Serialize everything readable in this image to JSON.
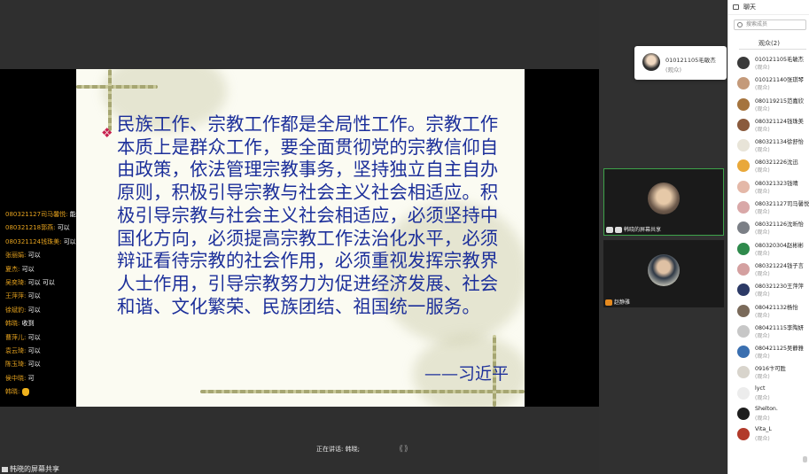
{
  "slide": {
    "bullet": "❖",
    "text": "民族工作、宗教工作都是全局性工作。宗教工作本质上是群众工作，要全面贯彻党的宗教信仰自由政策，依法管理宗教事务，坚持独立自主自办原则，积极引导宗教与社会主义社会相适应。积极引导宗教与社会主义社会相适应，必须坚持中国化方向，必须提高宗教工作法治化水平，必须辩证看待宗教的社会作用，必须重视发挥宗教界人士作用，引导宗教努力为促进经济发展、社会和谐、文化繁荣、民族团结、祖国统一服务。",
    "author": "——习近平"
  },
  "chat_overlay": [
    {
      "name": "080321127司马馨悦:",
      "text": "能"
    },
    {
      "name": "080321218郭燕:",
      "text": "可以"
    },
    {
      "name": "080321124钱珠美:",
      "text": "可以"
    },
    {
      "name": "张丽娟:",
      "text": "可以"
    },
    {
      "name": "夏杰:",
      "text": "可以"
    },
    {
      "name": "吴奕琦:",
      "text": "可以 可以"
    },
    {
      "name": "王萍萍:",
      "text": "可以"
    },
    {
      "name": "徐斌豹:",
      "text": "可以"
    },
    {
      "name": "韩晓:",
      "text": "收到"
    },
    {
      "name": "曹萍儿:",
      "text": "可以"
    },
    {
      "name": "袁云琦:",
      "text": "可以"
    },
    {
      "name": "陈玉琦:",
      "text": "可以"
    },
    {
      "name": "侯中晓:",
      "text": "可"
    },
    {
      "name": "韩晓:",
      "text": ""
    }
  ],
  "status": {
    "speaking": "正在讲话: 韩晓;",
    "share_label": "韩晓的屏幕共享",
    "controls_ghost": "⟪ ⟫"
  },
  "popup": {
    "name": "010121105毛敏杰",
    "status": "(观众)"
  },
  "tiles": [
    {
      "label": "韩晓的屏幕共享"
    },
    {
      "label": "赵静雅"
    }
  ],
  "panel": {
    "title": "聊天",
    "search_placeholder": "搜索成员",
    "member_count": "观众(2)",
    "members": [
      {
        "name": "010121105毛敏杰",
        "status": "(观众)",
        "color": "#3a3a3a"
      },
      {
        "name": "010121140张琪琴",
        "status": "(观众)",
        "color": "#c49a7a"
      },
      {
        "name": "080119215范嘉欣",
        "status": "(观众)",
        "color": "#a5743e"
      },
      {
        "name": "080321124钱珠美",
        "status": "(观众)",
        "color": "#8a5a3c"
      },
      {
        "name": "080321134徐舒怡",
        "status": "(观众)",
        "color": "#e8e4d8"
      },
      {
        "name": "080321226沈迅",
        "status": "(观众)",
        "color": "#e9a83a"
      },
      {
        "name": "080321323钱晴",
        "status": "(观众)",
        "color": "#e4b8a8"
      },
      {
        "name": "080321127司马馨悦",
        "status": "(观众)",
        "color": "#d9a8a8"
      },
      {
        "name": "080321126沈昕怡",
        "status": "(观众)",
        "color": "#7b7f86"
      },
      {
        "name": "080320304赵彬彬",
        "status": "(观众)",
        "color": "#2f8a4c"
      },
      {
        "name": "080321224钱子言",
        "status": "(观众)",
        "color": "#d4a0a0"
      },
      {
        "name": "080321230王萍萍",
        "status": "(观众)",
        "color": "#2c3a66"
      },
      {
        "name": "080421132杨怡",
        "status": "(观众)",
        "color": "#7a6a5a"
      },
      {
        "name": "080421115李陶妍",
        "status": "(观众)",
        "color": "#c7c7c7"
      },
      {
        "name": "080421125吴静雅",
        "status": "(观众)",
        "color": "#3a6fb0"
      },
      {
        "name": "0916卞可胜",
        "status": "(观众)",
        "color": "#d8d4cc"
      },
      {
        "name": "lyct",
        "status": "(观众)",
        "color": "#ececec"
      },
      {
        "name": "Shelton.",
        "status": "(观众)",
        "color": "#1e1e1e"
      },
      {
        "name": "Vita_L",
        "status": "(观众)",
        "color": "#b23a2a"
      }
    ]
  }
}
